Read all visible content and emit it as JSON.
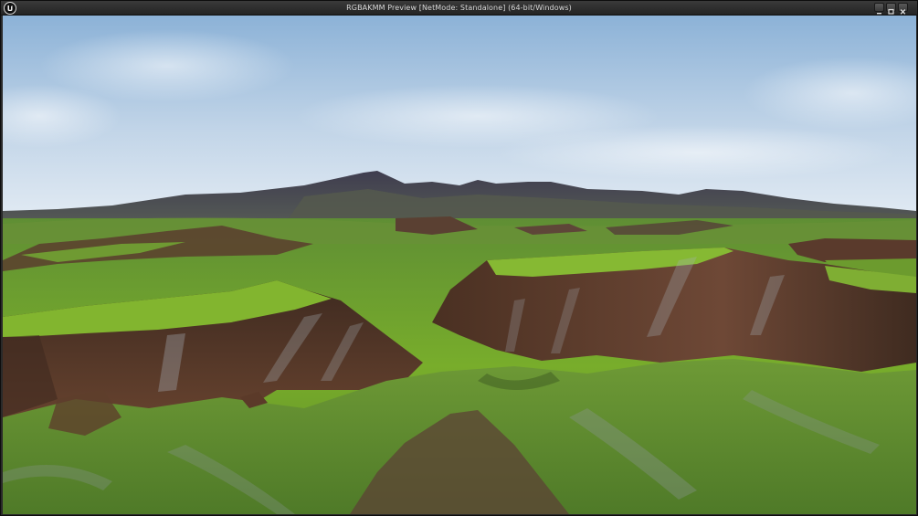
{
  "window": {
    "title": "RGBAKMM Preview [NetMode: Standalone]  (64-bit/Windows)",
    "icons": [
      "unreal-engine-logo",
      "minimize-icon",
      "maximize-icon",
      "close-icon"
    ]
  },
  "viewport": {
    "scene": "3d-landscape-render",
    "colors": {
      "sky_top": "#8fb4d8",
      "sky_horizon": "#dde7f1",
      "mountains": "#4b4a5c",
      "grass": "#6f9a2c",
      "cliff": "#5a3a28"
    }
  }
}
